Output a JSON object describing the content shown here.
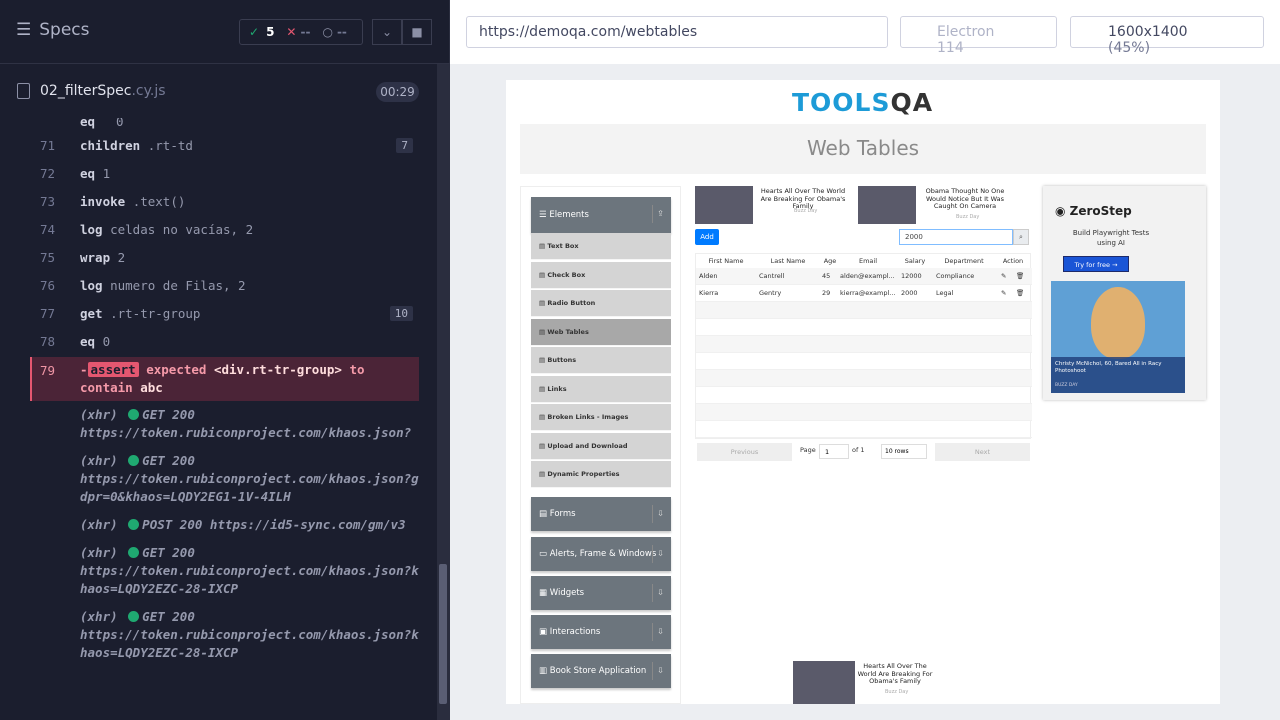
{
  "runner": {
    "specs_label": "Specs",
    "passed": "5",
    "failed": "--",
    "pending": "--",
    "file_name": "02_filterSpec",
    "file_ext": ".cy.js",
    "duration": "00:29"
  },
  "commands": [
    {
      "num": "71",
      "name": "children",
      "msg": ".rt-td",
      "badge": "7"
    },
    {
      "num": "72",
      "name": "eq",
      "msg": "1",
      "badge": ""
    },
    {
      "num": "73",
      "name": "invoke",
      "msg": ".text()",
      "badge": ""
    },
    {
      "num": "74",
      "name": "log",
      "msg": "celdas no vacías, 2",
      "badge": ""
    },
    {
      "num": "75",
      "name": "wrap",
      "msg": "2",
      "badge": ""
    },
    {
      "num": "76",
      "name": "log",
      "msg": "numero de Filas, 2",
      "badge": ""
    },
    {
      "num": "77",
      "name": "get",
      "msg": ".rt-tr-group",
      "badge": "10"
    },
    {
      "num": "78",
      "name": "eq",
      "msg": "0",
      "badge": ""
    }
  ],
  "assert": {
    "num": "79",
    "prefix": "-",
    "tag": "assert",
    "text1": "expected",
    "subject": "<div.rt-tr-group>",
    "text2": "to",
    "text3": "contain",
    "value": "abc"
  },
  "xhr": [
    {
      "type": "(xhr)",
      "method": "GET 200",
      "url": "https://token.rubiconproject.com/khaos.json?"
    },
    {
      "type": "(xhr)",
      "method": "GET 200",
      "url": "https://token.rubiconproject.com/khaos.json?gdpr=0&khaos=LQDY2EG1-1V-4ILH"
    },
    {
      "type": "(xhr)",
      "method": "POST 200",
      "url": "https://id5-sync.com/gm/v3"
    },
    {
      "type": "(xhr)",
      "method": "GET 200",
      "url": "https://token.rubiconproject.com/khaos.json?khaos=LQDY2EZC-28-IXCP"
    },
    {
      "type": "(xhr)",
      "method": "GET 200",
      "url": "https://token.rubiconproject.com/khaos.json?khaos=LQDY2EZC-28-IXCP"
    }
  ],
  "toolbar": {
    "url": "https://demoqa.com/webtables",
    "browser": "Electron 114",
    "viewport": "1600x1400",
    "scale": "(45%)"
  },
  "aut": {
    "logo_a": "TOOLS",
    "logo_b": "QA",
    "page_title": "Web Tables",
    "menu": {
      "elements": "Elements",
      "items": [
        "Text Box",
        "Check Box",
        "Radio Button",
        "Web Tables",
        "Buttons",
        "Links",
        "Broken Links - Images",
        "Upload and Download",
        "Dynamic Properties"
      ],
      "groups": [
        "Forms",
        "Alerts, Frame & Windows",
        "Widgets",
        "Interactions",
        "Book Store Application"
      ]
    },
    "ad1": {
      "text": "Hearts All Over The World Are Breaking For Obama's Family",
      "src": "Buzz Day"
    },
    "ad2": {
      "text": "Obama Thought No One Would Notice But It Was Caught On Camera",
      "src": "Buzz Day"
    },
    "add_label": "Add",
    "search_value": "2000",
    "columns": [
      "First Name",
      "Last Name",
      "Age",
      "Email",
      "Salary",
      "Department",
      "Action"
    ],
    "rows": [
      [
        "Alden",
        "Cantrell",
        "45",
        "alden@exampl...",
        "12000",
        "Compliance"
      ],
      [
        "Kierra",
        "Gentry",
        "29",
        "kierra@exampl...",
        "2000",
        "Legal"
      ]
    ],
    "pager": {
      "prev": "Previous",
      "page": "Page",
      "page_num": "1",
      "of": "of 1",
      "rows": "10 rows",
      "next": "Next"
    },
    "sidead": {
      "brand": "ZeroStep",
      "sub": "Build Playwright Tests using AI",
      "cta": "Try for free →",
      "caption": "Christy McNichol, 60, Bared All in Racy Photoshoot",
      "src": "BUZZ DAY"
    },
    "bottomad": {
      "text": "Hearts All Over The World Are Breaking For Obama's Family",
      "src": "Buzz Day"
    }
  }
}
